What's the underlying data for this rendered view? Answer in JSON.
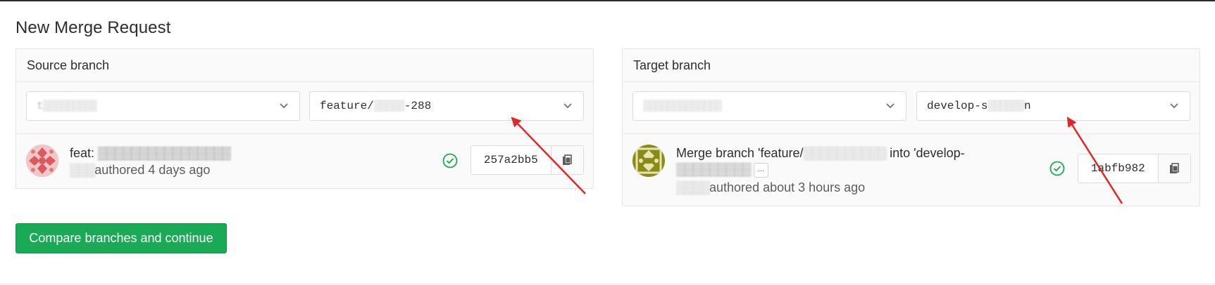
{
  "page": {
    "title": "New Merge Request"
  },
  "source": {
    "header": "Source branch",
    "project_select": {
      "value": "t▒▒▒▒▒▒▒▒▒"
    },
    "branch_select": {
      "prefix": "feature/",
      "masked": "▒▒▒▒▒",
      "suffix": "-288"
    },
    "commit": {
      "title_prefix": "feat: ",
      "title_masked": "▒▒▒▒▒▒▒▒▒▒▒▒▒▒▒▒",
      "author_masked": "▒▒▒",
      "meta": "authored 4 days ago",
      "sha": "257a2bb5",
      "status": "passed"
    }
  },
  "target": {
    "header": "Target branch",
    "project_select": {
      "value": "▒▒▒▒▒▒▒▒▒▒▒▒▒"
    },
    "branch_select": {
      "prefix": "develop-s",
      "masked": "▒▒▒▒▒▒",
      "suffix": "n"
    },
    "commit": {
      "title_prefix": "Merge branch 'feature/",
      "title_masked": "▒▒▒▒▒▒▒▒▒▒",
      "title_mid": " into 'develop-",
      "title_line2_masked": "▒▒▒▒▒▒▒▒▒",
      "ellipsis": "...",
      "author_masked": "▒▒▒▒",
      "meta": "authored about 3 hours ago",
      "sha": "1abfb982",
      "status": "passed"
    }
  },
  "actions": {
    "compare_label": "Compare branches and continue"
  },
  "colors": {
    "success": "#1aaa55",
    "annotation_arrow": "#e32527"
  },
  "icons": [
    "chevron-down-icon",
    "check-circle-icon",
    "clipboard-icon",
    "avatar-identicon",
    "annotation-arrow"
  ]
}
